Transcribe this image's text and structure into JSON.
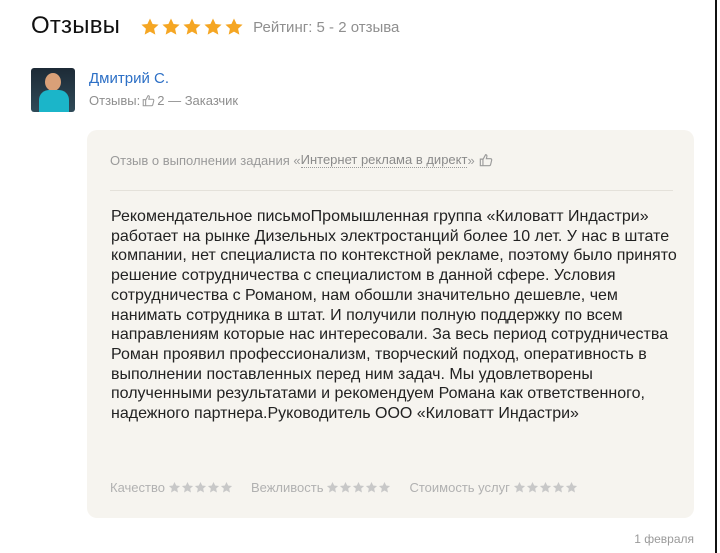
{
  "header": {
    "title": "Отзывы",
    "rating_text": "Рейтинг: 5 - 2 отзыва",
    "stars_filled": 5,
    "star_color": "#f5a623"
  },
  "reviewer": {
    "name": "Дмитрий С.",
    "reviews_label": "Отзывы:",
    "reviews_count": "2 — Заказчик"
  },
  "review": {
    "task_prefix": "Отзыв о выполнении задания «",
    "task_link": "Интернет реклама в директ",
    "task_suffix": "»",
    "text": "Рекомендательное письмоПромышленная группа «Киловатт Индастри» работает на рынке Дизельных электростанций более 10 лет. У нас в штате компании, нет специалиста по контекстной рекламе, поэтому было принято решение сотрудничества с специалистом в данной сфере. Условия сотрудничества с Романом, нам обошли значительно дешевле, чем нанимать сотрудника в штат. И получили полную поддержку по всем направлениям которые нас интересовали. За весь период сотрудничества Роман проявил профессионализм, творческий подход, оперативность в выполнении поставленных перед ним задач. Мы удовлетворены полученными результатами и рекомендуем Романа как ответственного, надежного партнера.Руководитель ООО «Киловатт Индастри»",
    "criteria": [
      {
        "label": "Качество",
        "stars": 5
      },
      {
        "label": "Вежливость",
        "stars": 5
      },
      {
        "label": "Стоимость услуг",
        "stars": 5
      }
    ],
    "date": "1 февраля"
  }
}
